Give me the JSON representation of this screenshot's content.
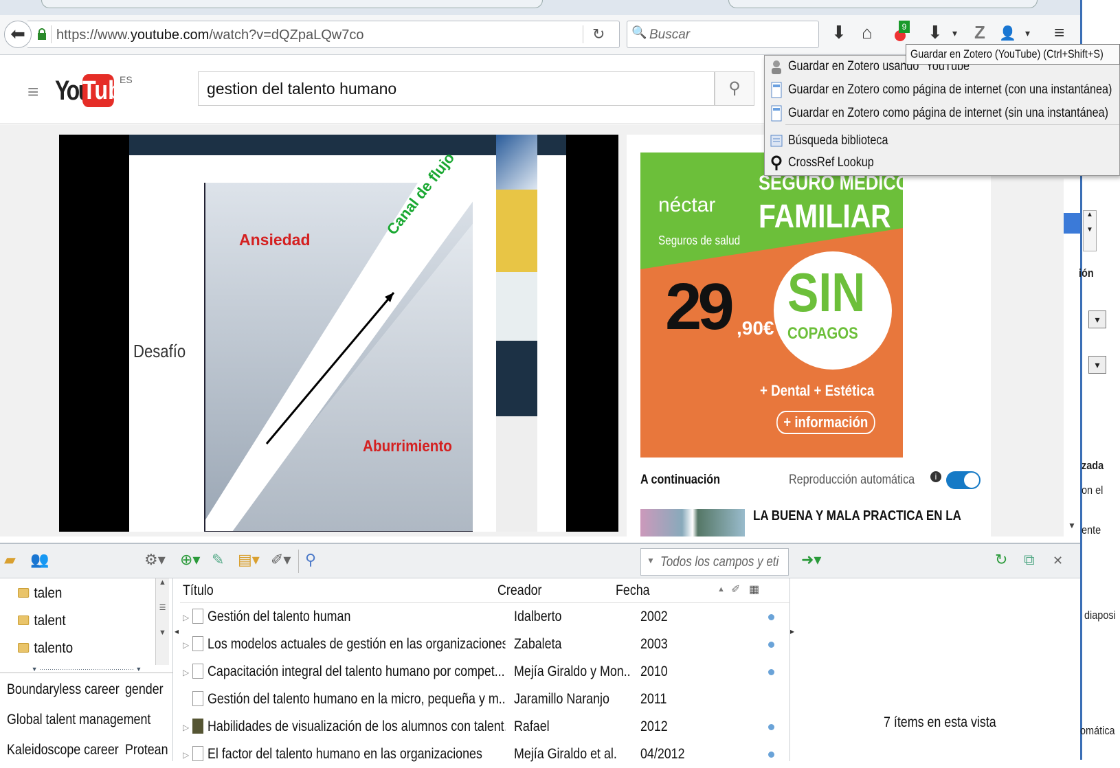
{
  "browser": {
    "url_prefix": "https://www.",
    "url_domain": "youtube.com",
    "url_path": "/watch?v=dQZpaLQw7co",
    "search_placeholder": "Buscar",
    "badge_count": "9"
  },
  "tooltip": "Guardar en Zotero (YouTube) (Ctrl+Shift+S)",
  "zotero_menu": {
    "items": [
      {
        "label": "Guardar en Zotero usando \"YouTube\"",
        "icon": "user-icon"
      },
      {
        "label": "Guardar en Zotero como página de internet (con una instantánea)",
        "icon": "webpage-icon"
      },
      {
        "label": "Guardar en Zotero como página de internet (sin una instantánea)",
        "icon": "webpage-icon"
      },
      {
        "label": "Búsqueda biblioteca",
        "icon": "library-icon"
      },
      {
        "label": "CrossRef Lookup",
        "icon": "crossref-icon"
      }
    ]
  },
  "youtube": {
    "logo_you": "You",
    "logo_tube": "Tube",
    "region": "ES",
    "search_query": "gestion del talento humano"
  },
  "video": {
    "label_anxiety": "Ansiedad",
    "label_flow": "Canal de flujo",
    "label_challenge": "Desafío",
    "label_boredom": "Aburrimiento"
  },
  "ad": {
    "brand": "néctar",
    "brand_sub": "Seguros de salud",
    "line1": "SEGURO MÉDICO",
    "line2": "FAMILIAR",
    "price_main": "29",
    "price_cents": ",90€",
    "badge_big": "SIN",
    "badge_small": "COPAGOS",
    "extras": "+ Dental  + Estética",
    "cta": "+ información"
  },
  "up_next": {
    "title": "A continuación",
    "autoplay": "Reproducción automática",
    "next_video": "LA BUENA Y MALA PRACTICA EN LA"
  },
  "right_panel": {
    "t1": "ión",
    "t2": "zada",
    "t3": "on el",
    "t4": "ente",
    "t5": "diaposi",
    "t6": "omática"
  },
  "zotero": {
    "search_placeholder": "Todos los campos y eti",
    "collections": [
      "talen",
      "talent",
      "talento"
    ],
    "tags": [
      "Boundaryless career",
      "gender",
      "Global talent management",
      "Kaleidoscope career",
      "Protean"
    ],
    "columns": {
      "title": "Título",
      "creator": "Creador",
      "date": "Fecha"
    },
    "items": [
      {
        "title": "Gestión del talento human",
        "creator": "Idalberto",
        "date": "2002"
      },
      {
        "title": "Los modelos actuales de gestión en las organizaciones...",
        "creator": "Zabaleta",
        "date": "2003"
      },
      {
        "title": "Capacitación integral del talento humano por compet...",
        "creator": "Mejía Giraldo y Mon...",
        "date": "2010"
      },
      {
        "title": "Gestión del talento humano en la micro, pequeña y m...",
        "creator": "Jaramillo Naranjo",
        "date": "2011"
      },
      {
        "title": "Habilidades de visualización de los alumnos con talent...",
        "creator": "Rafael",
        "date": "2012"
      },
      {
        "title": "El factor del talento humano en las organizaciones",
        "creator": "Mejía Giraldo et al.",
        "date": "04/2012"
      }
    ],
    "count_label": "7 ítems en esta vista"
  }
}
